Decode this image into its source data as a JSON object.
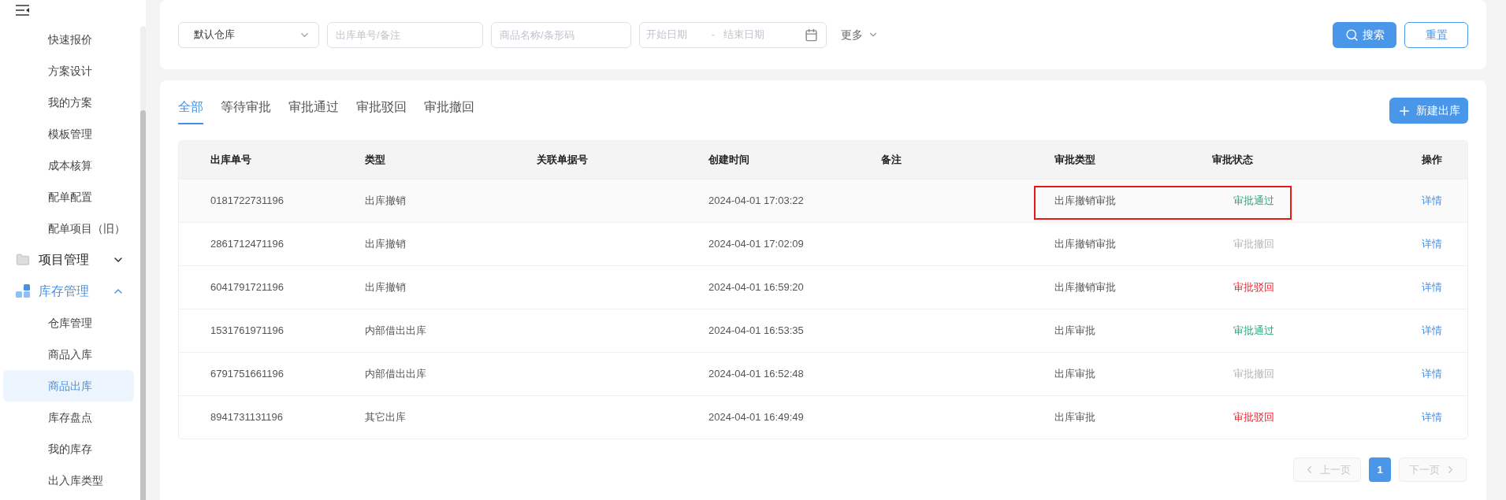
{
  "sidebar": {
    "items": [
      {
        "kind": "item",
        "label": "快速报价",
        "selected": false
      },
      {
        "kind": "item",
        "label": "方案设计",
        "selected": false
      },
      {
        "kind": "item",
        "label": "我的方案",
        "selected": false
      },
      {
        "kind": "item",
        "label": "模板管理",
        "selected": false
      },
      {
        "kind": "item",
        "label": "成本核算",
        "selected": false
      },
      {
        "kind": "item",
        "label": "配单配置",
        "selected": false
      },
      {
        "kind": "item",
        "label": "配单项目（旧）",
        "selected": false
      },
      {
        "kind": "group",
        "label": "项目管理",
        "expanded": false,
        "active": false
      },
      {
        "kind": "group",
        "label": "库存管理",
        "expanded": true,
        "active": true
      },
      {
        "kind": "item",
        "label": "仓库管理",
        "selected": false
      },
      {
        "kind": "item",
        "label": "商品入库",
        "selected": false
      },
      {
        "kind": "item",
        "label": "商品出库",
        "selected": true
      },
      {
        "kind": "item",
        "label": "库存盘点",
        "selected": false
      },
      {
        "kind": "item",
        "label": "我的库存",
        "selected": false
      },
      {
        "kind": "item",
        "label": "出入库类型",
        "selected": false
      }
    ]
  },
  "filters": {
    "warehouse": "默认仓库",
    "order_search": {
      "placeholder": "出库单号/备注"
    },
    "product_search": {
      "placeholder": "商品名称/条形码"
    },
    "start_date": {
      "placeholder": "开始日期"
    },
    "date_separator": "-",
    "end_date": {
      "placeholder": "结束日期"
    },
    "more": "更多",
    "search_button": "搜索",
    "reset_button": "重置"
  },
  "tabs": [
    {
      "label": "全部",
      "selected": true
    },
    {
      "label": "等待审批",
      "selected": false
    },
    {
      "label": "审批通过",
      "selected": false
    },
    {
      "label": "审批驳回",
      "selected": false
    },
    {
      "label": "审批撤回",
      "selected": false
    }
  ],
  "new_button": "新建出库",
  "table": {
    "columns": [
      "出库单号",
      "类型",
      "关联单据号",
      "创建时间",
      "备注",
      "审批类型",
      "审批状态",
      "操作"
    ],
    "rows": [
      {
        "id": "0181722731196",
        "type": "出库撤销",
        "created": "2024-04-01 17:03:22",
        "approval_type": "出库撤销审批",
        "status": {
          "kind": "approved",
          "label": "审批通过"
        },
        "action": "详情",
        "highlighted": true
      },
      {
        "id": "2861712471196",
        "type": "出库撤销",
        "created": "2024-04-01 17:02:09",
        "approval_type": "出库撤销审批",
        "status": {
          "kind": "withdrawn",
          "label": "审批撤回"
        },
        "action": "详情",
        "highlighted": false
      },
      {
        "id": "6041791721196",
        "type": "出库撤销",
        "created": "2024-04-01 16:59:20",
        "approval_type": "出库撤销审批",
        "status": {
          "kind": "rejected",
          "label": "审批驳回"
        },
        "action": "详情",
        "highlighted": false
      },
      {
        "id": "1531761971196",
        "type": "内部借出出库",
        "created": "2024-04-01 16:53:35",
        "approval_type": "出库审批",
        "status": {
          "kind": "approved",
          "label": "审批通过"
        },
        "action": "详情",
        "highlighted": false
      },
      {
        "id": "6791751661196",
        "type": "内部借出出库",
        "created": "2024-04-01 16:52:48",
        "approval_type": "出库审批",
        "status": {
          "kind": "withdrawn",
          "label": "审批撤回"
        },
        "action": "详情",
        "highlighted": false
      },
      {
        "id": "8941731131196",
        "type": "其它出库",
        "created": "2024-04-01 16:49:49",
        "approval_type": "出库审批",
        "status": {
          "kind": "rejected",
          "label": "审批驳回"
        },
        "action": "详情",
        "highlighted": false
      }
    ]
  },
  "pagination": {
    "prev": "上一页",
    "pages": [
      {
        "label": "1",
        "selected": true
      }
    ],
    "next": "下一页"
  }
}
